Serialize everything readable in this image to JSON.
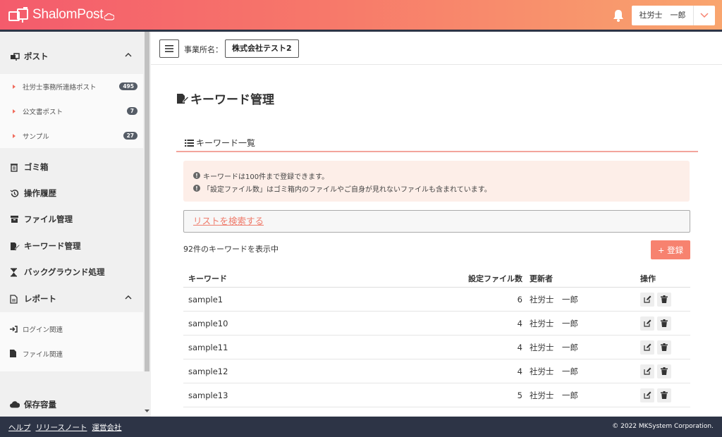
{
  "header": {
    "app_name": "ShalomPost",
    "user_name": "社労士　一郎"
  },
  "sidebar": {
    "post": {
      "label": "ポスト",
      "items": [
        {
          "label": "社労士事務所連絡ポスト",
          "badge": "495"
        },
        {
          "label": "公文書ポスト",
          "badge": "7"
        },
        {
          "label": "サンプル",
          "badge": "27"
        }
      ]
    },
    "trash": "ゴミ箱",
    "history": "操作履歴",
    "file_mgmt": "ファイル管理",
    "keyword_mgmt": "キーワード管理",
    "background": "バックグラウンド処理",
    "report": {
      "label": "レポート",
      "items": [
        "ログイン関連",
        "ファイル関連"
      ]
    },
    "storage": "保存容量"
  },
  "topbar": {
    "office_label": "事業所名：",
    "office_name": "株式会社テスト2"
  },
  "main": {
    "page_title": "キーワード管理",
    "card_title": "キーワード一覧",
    "alerts": [
      "キーワードは100件まで登録できます。",
      "「設定ファイル数」はゴミ箱内のファイルやご自身が見れないファイルも含まれています。"
    ],
    "search_link": "リストを検索する",
    "count_text": "92件のキーワードを表示中",
    "register_label": "+ 登録",
    "table": {
      "headers": [
        "キーワード",
        "設定ファイル数",
        "更新者",
        "操作"
      ],
      "rows": [
        {
          "keyword": "sample1",
          "count": "6",
          "updater": "社労士　一郎"
        },
        {
          "keyword": "sample10",
          "count": "4",
          "updater": "社労士　一郎"
        },
        {
          "keyword": "sample11",
          "count": "4",
          "updater": "社労士　一郎"
        },
        {
          "keyword": "sample12",
          "count": "4",
          "updater": "社労士　一郎"
        },
        {
          "keyword": "sample13",
          "count": "5",
          "updater": "社労士　一郎"
        }
      ]
    }
  },
  "footer": {
    "links": [
      "ヘルプ",
      "リリースノート",
      "運営会社"
    ],
    "copyright": "© 2022 MKSystem Corporation."
  },
  "colors": {
    "header_start": "#f45b6c",
    "header_end": "#f9a56e",
    "accent": "#f7826f",
    "footer_bg": "#2d3446"
  }
}
